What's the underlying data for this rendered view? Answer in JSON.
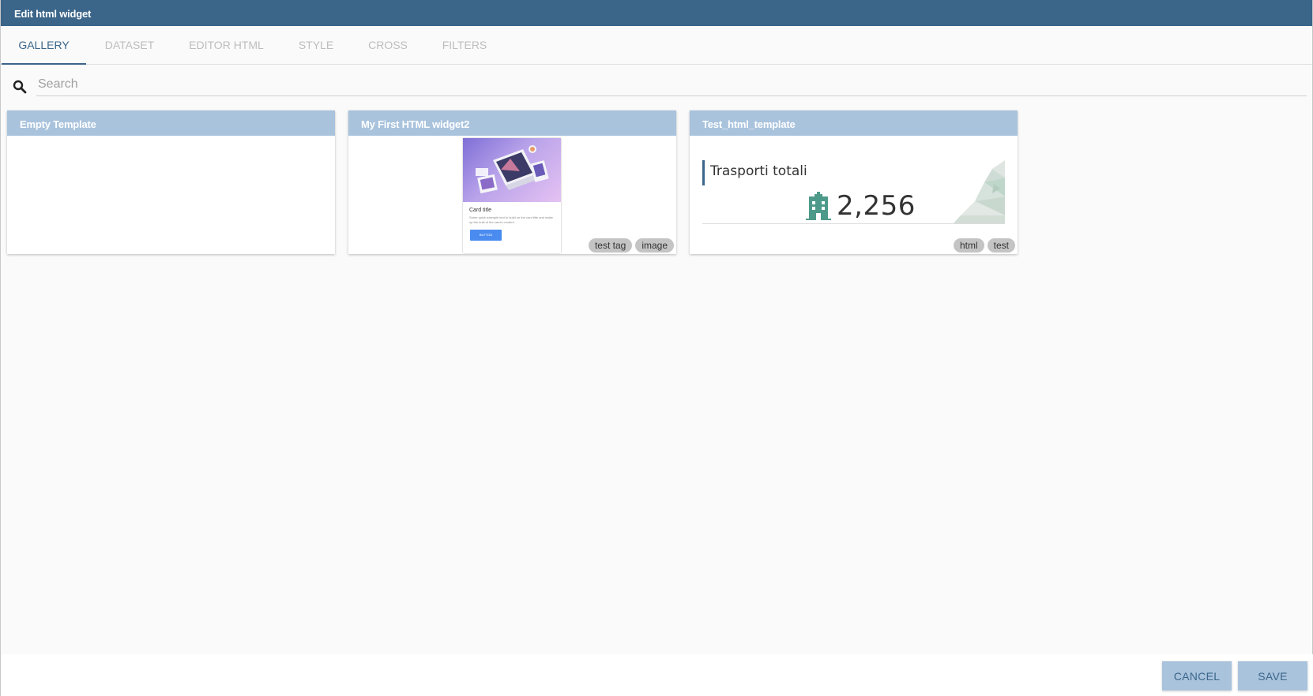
{
  "window": {
    "title": "Edit html widget"
  },
  "tabs": [
    {
      "label": "GALLERY",
      "active": true
    },
    {
      "label": "DATASET",
      "active": false
    },
    {
      "label": "EDITOR HTML",
      "active": false
    },
    {
      "label": "STYLE",
      "active": false
    },
    {
      "label": "CROSS",
      "active": false
    },
    {
      "label": "FILTERS",
      "active": false
    }
  ],
  "search": {
    "icon": "search-icon",
    "placeholder": "Search",
    "value": ""
  },
  "gallery": [
    {
      "title": "Empty Template",
      "tags": []
    },
    {
      "title": "My First HTML widget2",
      "preview": {
        "card_title": "Card title",
        "card_text": "Some quick example text to build on the card title and make up the bulk of the card's content.",
        "button_label": "BUTTON"
      },
      "tags": [
        "test tag",
        "image"
      ]
    },
    {
      "title": "Test_html_template",
      "preview": {
        "label": "Trasporti totali",
        "value": "2,256",
        "icon": "hospital-icon"
      },
      "tags": [
        "html",
        "test"
      ]
    }
  ],
  "footer": {
    "cancel_label": "CANCEL",
    "save_label": "SAVE"
  },
  "colors": {
    "primary": "#3b6589",
    "card_header": "#a9c3dd",
    "tag_bg": "#c4c4c4",
    "kpi_icon": "#4e9a8a"
  }
}
